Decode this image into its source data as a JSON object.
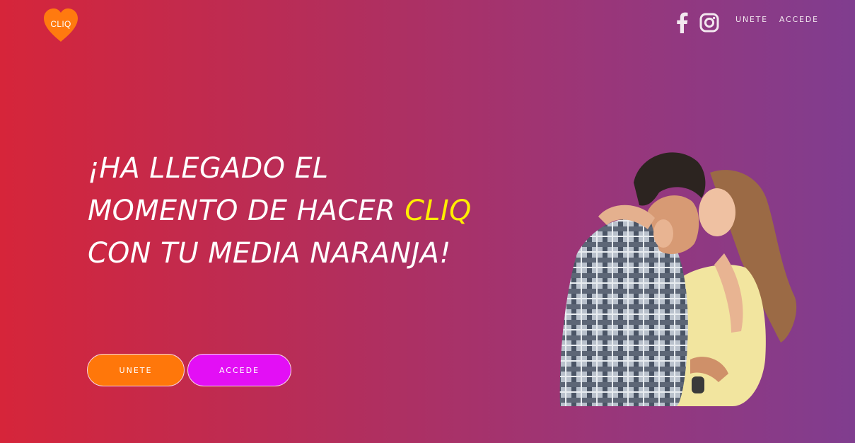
{
  "brand": {
    "logo_text": "CLIQ",
    "logo_color": "#ff7a0f"
  },
  "header": {
    "social": [
      {
        "icon": "facebook-icon"
      },
      {
        "icon": "instagram-icon"
      }
    ],
    "nav": {
      "join_label": "UNETE",
      "login_label": "ACCEDE"
    }
  },
  "hero": {
    "headline_before": "¡HA LLEGADO EL MOMENTO DE HACER ",
    "headline_accent": "CLIQ",
    "headline_after": " CON TU MEDIA NARANJA!",
    "accent_color": "#ffee00",
    "join_button_label": "UNETE",
    "login_button_label": "ACCEDE",
    "photo_subject": "couple-kissing-photo"
  },
  "colors": {
    "gradient_start": "#d6253a",
    "gradient_end": "#803d8f",
    "join_button": "#ff770a",
    "login_button": "#e30ff5"
  }
}
